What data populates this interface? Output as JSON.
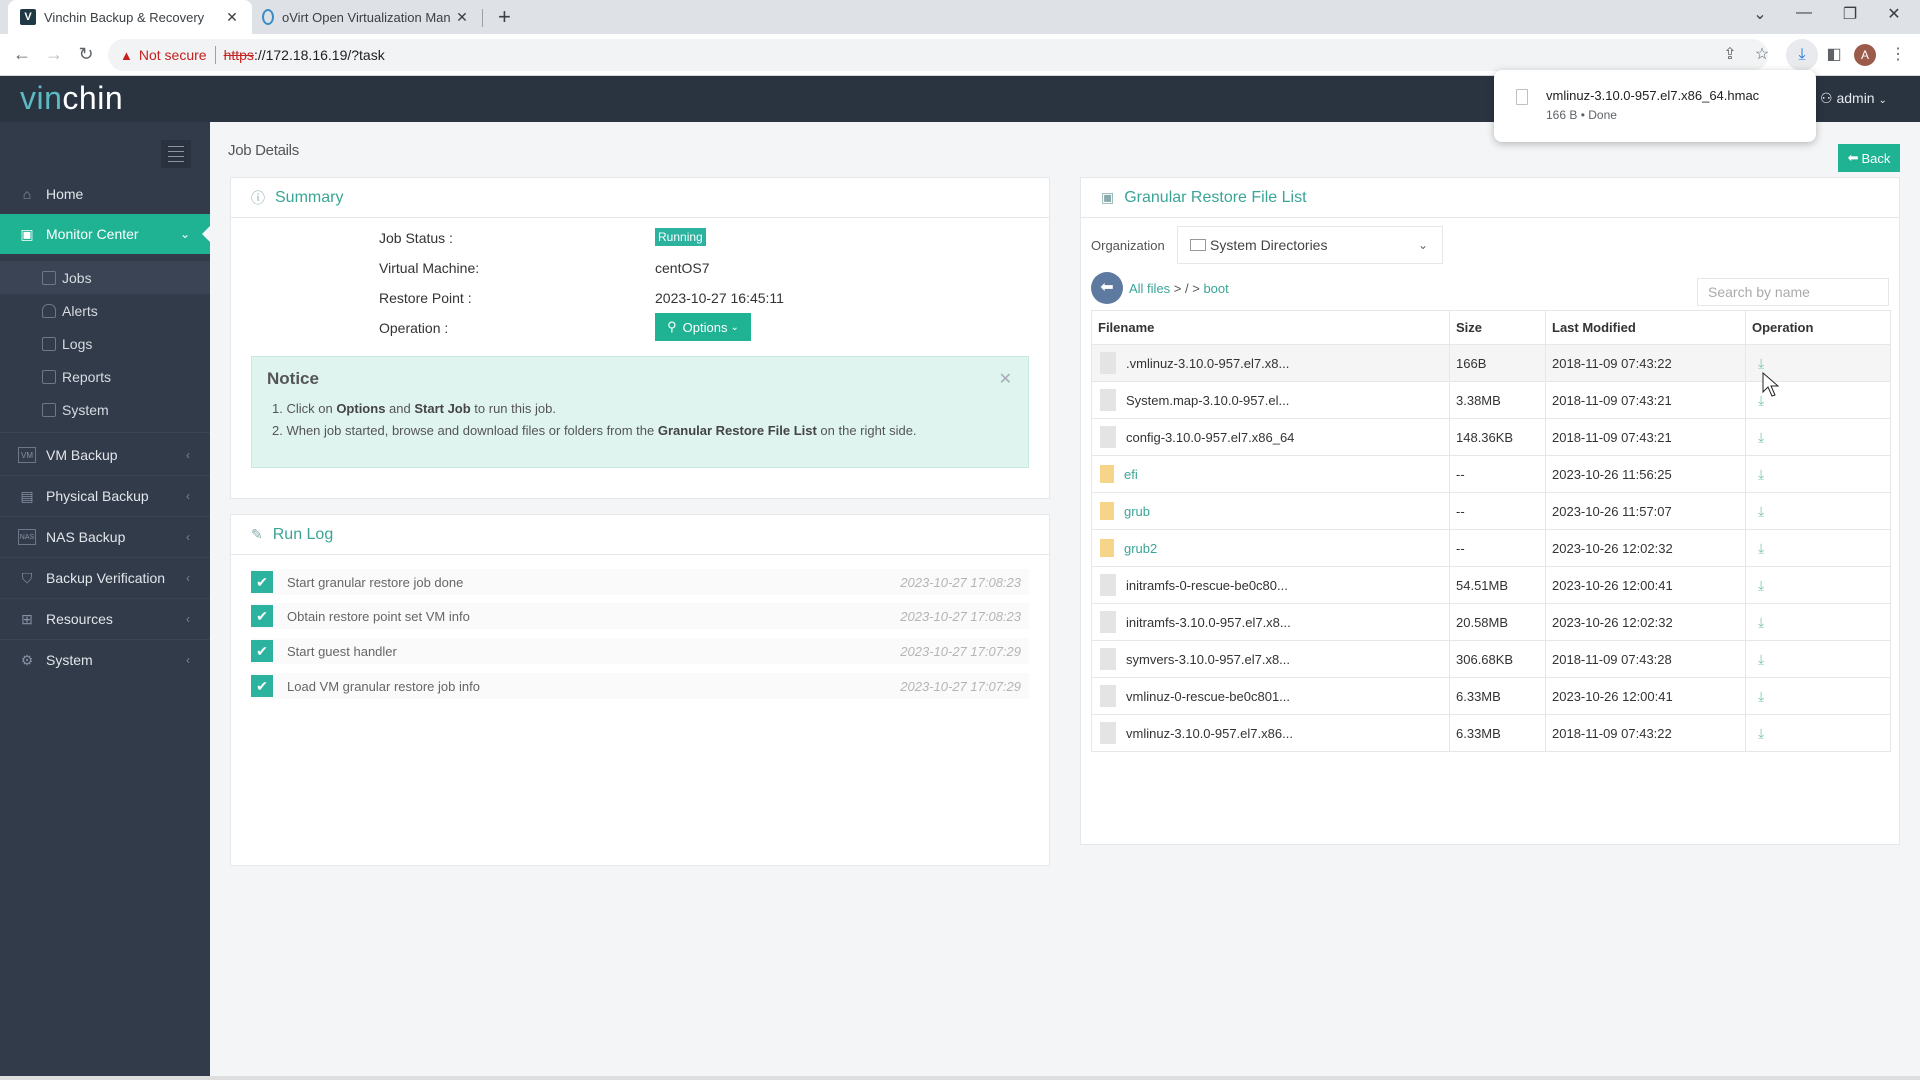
{
  "browser": {
    "tabs": [
      {
        "title": "Vinchin Backup & Recovery",
        "favicon": "V",
        "active": true
      },
      {
        "title": "oVirt Open Virtualization Man",
        "favicon": "O",
        "active": false
      }
    ],
    "new_tab": "+",
    "security_label": "Not secure",
    "url_scheme": "https",
    "url_rest": "://172.18.16.19/?task",
    "profile_initial": "A",
    "download_popup": {
      "filename": "vmlinuz-3.10.0-957.el7.x86_64.hmac",
      "meta": "166 B • Done"
    }
  },
  "app": {
    "logo_part1": "vin",
    "logo_part2": "chin",
    "user": "admin"
  },
  "sidebar": {
    "items": [
      {
        "label": "Home",
        "icon": "home-icon"
      },
      {
        "label": "Monitor Center",
        "icon": "monitor-icon",
        "active": true
      },
      {
        "label": "VM Backup",
        "icon": "vm-icon"
      },
      {
        "label": "Physical Backup",
        "icon": "physical-icon"
      },
      {
        "label": "NAS Backup",
        "icon": "nas-icon"
      },
      {
        "label": "Backup Verification",
        "icon": "shield-icon"
      },
      {
        "label": "Resources",
        "icon": "grid-icon"
      },
      {
        "label": "System",
        "icon": "gear-icon"
      }
    ],
    "sub_items": [
      {
        "label": "Jobs",
        "active": true
      },
      {
        "label": "Alerts"
      },
      {
        "label": "Logs"
      },
      {
        "label": "Reports"
      },
      {
        "label": "System"
      }
    ]
  },
  "main": {
    "page_title": "Job Details",
    "back_label": "Back",
    "summary": {
      "title": "Summary",
      "job_status_label": "Job Status :",
      "job_status_value": "Running",
      "vm_label": "Virtual Machine:",
      "vm_value": "centOS7",
      "restore_point_label": "Restore Point :",
      "restore_point_value": "2023-10-27 16:45:11",
      "operation_label": "Operation :",
      "options_label": "Options",
      "notice": {
        "title": "Notice",
        "line1_pre": "1. Click on ",
        "line1_b1": "Options",
        "line1_mid": " and ",
        "line1_b2": "Start Job",
        "line1_post": " to run this job.",
        "line2_pre": "2. When job started, browse and download files or folders from the ",
        "line2_b": "Granular Restore File List",
        "line2_post": " on the right side."
      }
    },
    "run_log": {
      "title": "Run Log",
      "entries": [
        {
          "text": "Start granular restore job done",
          "time": "2023-10-27 17:08:23"
        },
        {
          "text": "Obtain restore point set VM info",
          "time": "2023-10-27 17:08:23"
        },
        {
          "text": "Start guest handler",
          "time": "2023-10-27 17:07:29"
        },
        {
          "text": "Load VM granular restore job info",
          "time": "2023-10-27 17:07:29"
        }
      ]
    },
    "file_list": {
      "title": "Granular Restore File List",
      "organization_label": "Organization",
      "organization_value": "System Directories",
      "breadcrumb_all": "All files",
      "breadcrumb_sep1": " > / > ",
      "breadcrumb_current": "boot",
      "search_placeholder": "Search by name",
      "columns": [
        "Filename",
        "Size",
        "Last Modified",
        "Operation"
      ],
      "rows": [
        {
          "name": ".vmlinuz-3.10.0-957.el7.x8...",
          "size": "166B",
          "modified": "2018-11-09 07:43:22",
          "type": "file"
        },
        {
          "name": "System.map-3.10.0-957.el...",
          "size": "3.38MB",
          "modified": "2018-11-09 07:43:21",
          "type": "file"
        },
        {
          "name": "config-3.10.0-957.el7.x86_64",
          "size": "148.36KB",
          "modified": "2018-11-09 07:43:21",
          "type": "file"
        },
        {
          "name": "efi",
          "size": "--",
          "modified": "2023-10-26 11:56:25",
          "type": "folder"
        },
        {
          "name": "grub",
          "size": "--",
          "modified": "2023-10-26 11:57:07",
          "type": "folder"
        },
        {
          "name": "grub2",
          "size": "--",
          "modified": "2023-10-26 12:02:32",
          "type": "folder"
        },
        {
          "name": "initramfs-0-rescue-be0c80...",
          "size": "54.51MB",
          "modified": "2023-10-26 12:00:41",
          "type": "file"
        },
        {
          "name": "initramfs-3.10.0-957.el7.x8...",
          "size": "20.58MB",
          "modified": "2023-10-26 12:02:32",
          "type": "file"
        },
        {
          "name": "symvers-3.10.0-957.el7.x8...",
          "size": "306.68KB",
          "modified": "2018-11-09 07:43:28",
          "type": "file"
        },
        {
          "name": "vmlinuz-0-rescue-be0c801...",
          "size": "6.33MB",
          "modified": "2023-10-26 12:00:41",
          "type": "file"
        },
        {
          "name": "vmlinuz-3.10.0-957.el7.x86...",
          "size": "6.33MB",
          "modified": "2018-11-09 07:43:22",
          "type": "file"
        }
      ]
    }
  },
  "colors": {
    "accent": "#1fb394",
    "sidebar_bg": "#323b4a",
    "header_bg": "#2a3440",
    "link": "#3aa597"
  }
}
